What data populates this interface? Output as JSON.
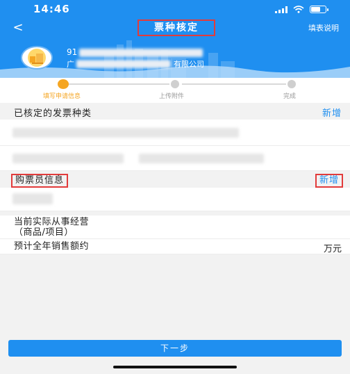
{
  "status_bar": {
    "time": "14:46"
  },
  "nav": {
    "back_glyph": "<",
    "title": "票种核定",
    "help_label": "填表说明"
  },
  "company": {
    "id_partial": "91",
    "name_partial": "广",
    "name_suffix": "有限公司"
  },
  "steps": [
    {
      "label": "填写申请信息",
      "active": true
    },
    {
      "label": "上传附件",
      "active": false
    },
    {
      "label": "完成",
      "active": false
    }
  ],
  "invoice_types": {
    "title": "已核定的发票种类",
    "action_label": "新增"
  },
  "buyer_info": {
    "title": "购票员信息",
    "action_label": "新增"
  },
  "business": {
    "label_line1": "当前实际从事经营",
    "label_line2": "（商品/项目）"
  },
  "annual_sales": {
    "label": "预计全年销售额约",
    "unit": "万元"
  },
  "footer": {
    "next_label": "下一步"
  },
  "colors": {
    "brand_blue": "#1f8ff0",
    "active_step": "#f5a623",
    "highlight_red": "#e23b3b"
  }
}
